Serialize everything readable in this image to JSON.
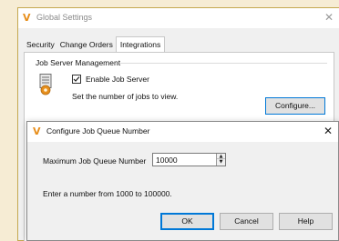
{
  "window": {
    "title": "Global Settings",
    "close_glyph": "✕"
  },
  "tabs": [
    {
      "label": "Security",
      "active": false
    },
    {
      "label": "Change Orders",
      "active": false
    },
    {
      "label": "Integrations",
      "active": true
    }
  ],
  "job_server": {
    "group_label": "Job Server Management",
    "enable_label": "Enable Job Server",
    "enable_checked": true,
    "description": "Set the number of jobs to view.",
    "configure_label": "Configure..."
  },
  "dialog": {
    "title": "Configure Job Queue Number",
    "close_glyph": "✕",
    "max_label": "Maximum Job Queue Number",
    "max_value": "10000",
    "hint": "Enter a number from 1000 to 100000.",
    "ok_label": "OK",
    "cancel_label": "Cancel",
    "help_label": "Help"
  },
  "icons": {
    "app": "vault-app-icon",
    "server": "job-server-icon"
  },
  "colors": {
    "accent": "#0078d7",
    "app_icon": "#e78f1c",
    "desktop": "#f6ecd4"
  }
}
